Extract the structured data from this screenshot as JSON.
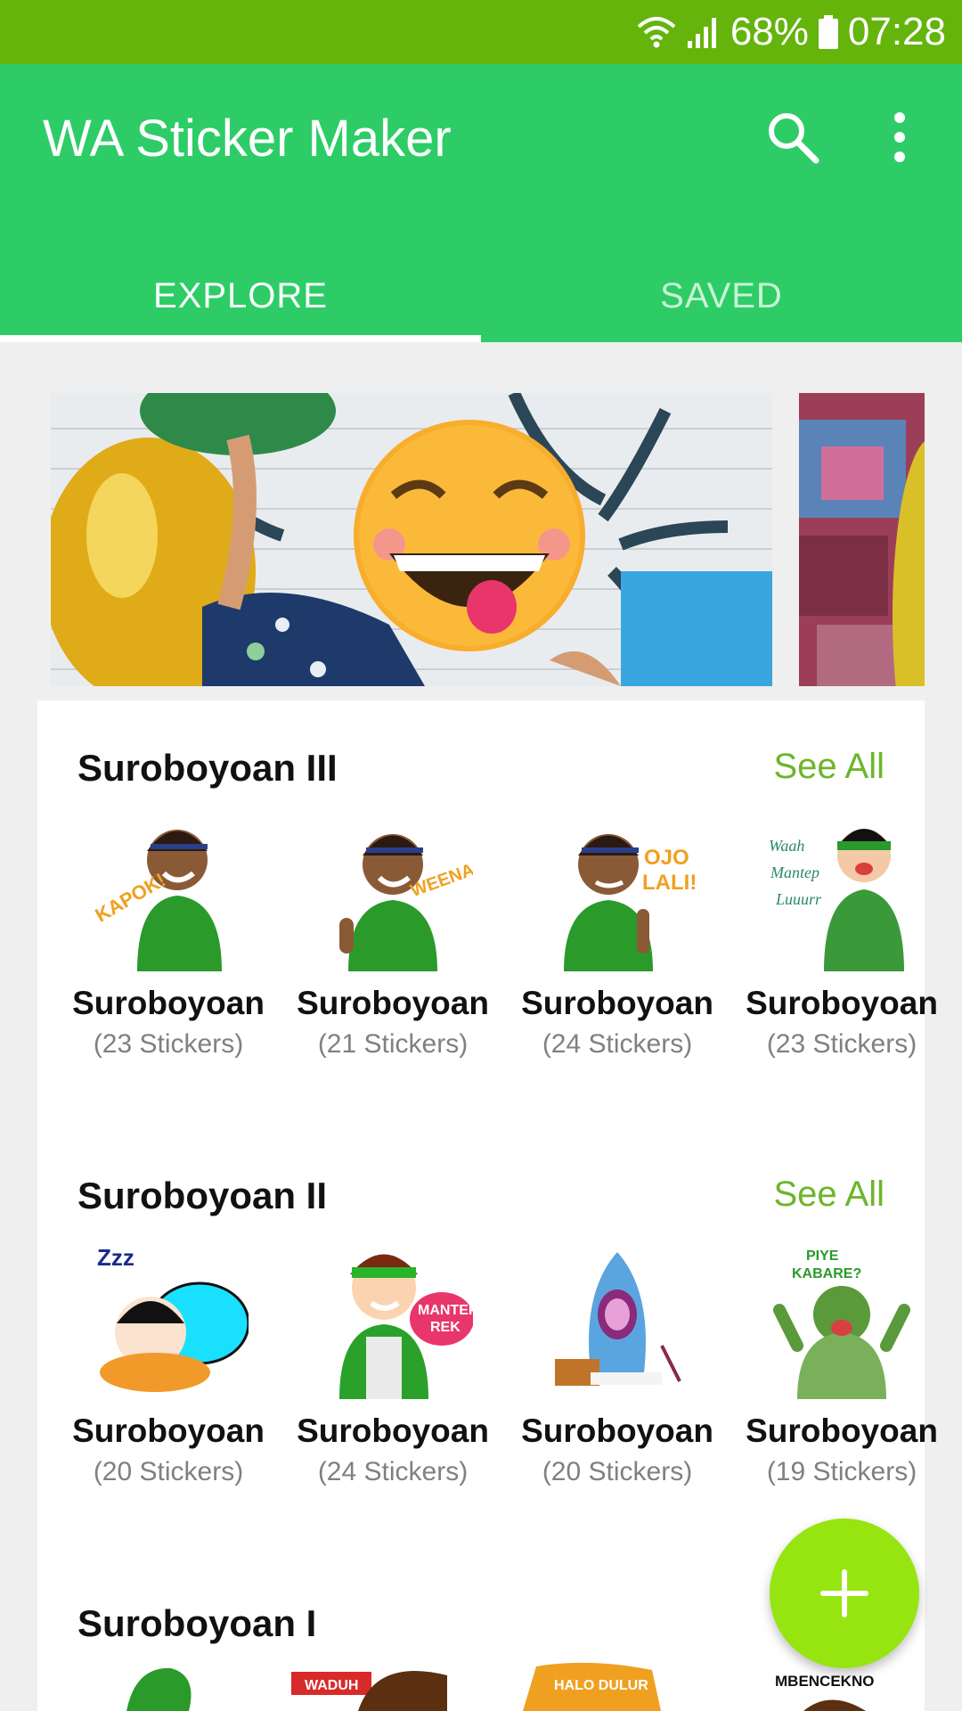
{
  "status_bar": {
    "battery": "68%",
    "time": "07:28"
  },
  "app_bar": {
    "title": "WA Sticker Maker",
    "search_icon": "search-icon",
    "menu_icon": "more-vert-icon"
  },
  "tabs": [
    {
      "label": "EXPLORE",
      "active": true
    },
    {
      "label": "SAVED",
      "active": false
    }
  ],
  "sections": [
    {
      "title": "Suroboyoan III",
      "see_all": "See All",
      "packs": [
        {
          "name": "Suroboyoan",
          "count": "(23 Stickers)"
        },
        {
          "name": "Suroboyoan",
          "count": "(21 Stickers)"
        },
        {
          "name": "Suroboyoan",
          "count": "(24 Stickers)"
        },
        {
          "name": "Suroboyoan",
          "count": "(23 Stickers)"
        }
      ]
    },
    {
      "title": "Suroboyoan II",
      "see_all": "See All",
      "packs": [
        {
          "name": "Suroboyoan",
          "count": "(20 Stickers)"
        },
        {
          "name": "Suroboyoan",
          "count": "(24 Stickers)"
        },
        {
          "name": "Suroboyoan",
          "count": "(20 Stickers)"
        },
        {
          "name": "Suroboyoan",
          "count": "(19 Stickers)"
        }
      ]
    },
    {
      "title": "Suroboyoan I"
    }
  ],
  "fab": {
    "icon": "plus-icon"
  },
  "colors": {
    "status_bar": "#64b40c",
    "app_bar": "#2ecc67",
    "see_all": "#6db52a",
    "fab": "#96e510"
  }
}
